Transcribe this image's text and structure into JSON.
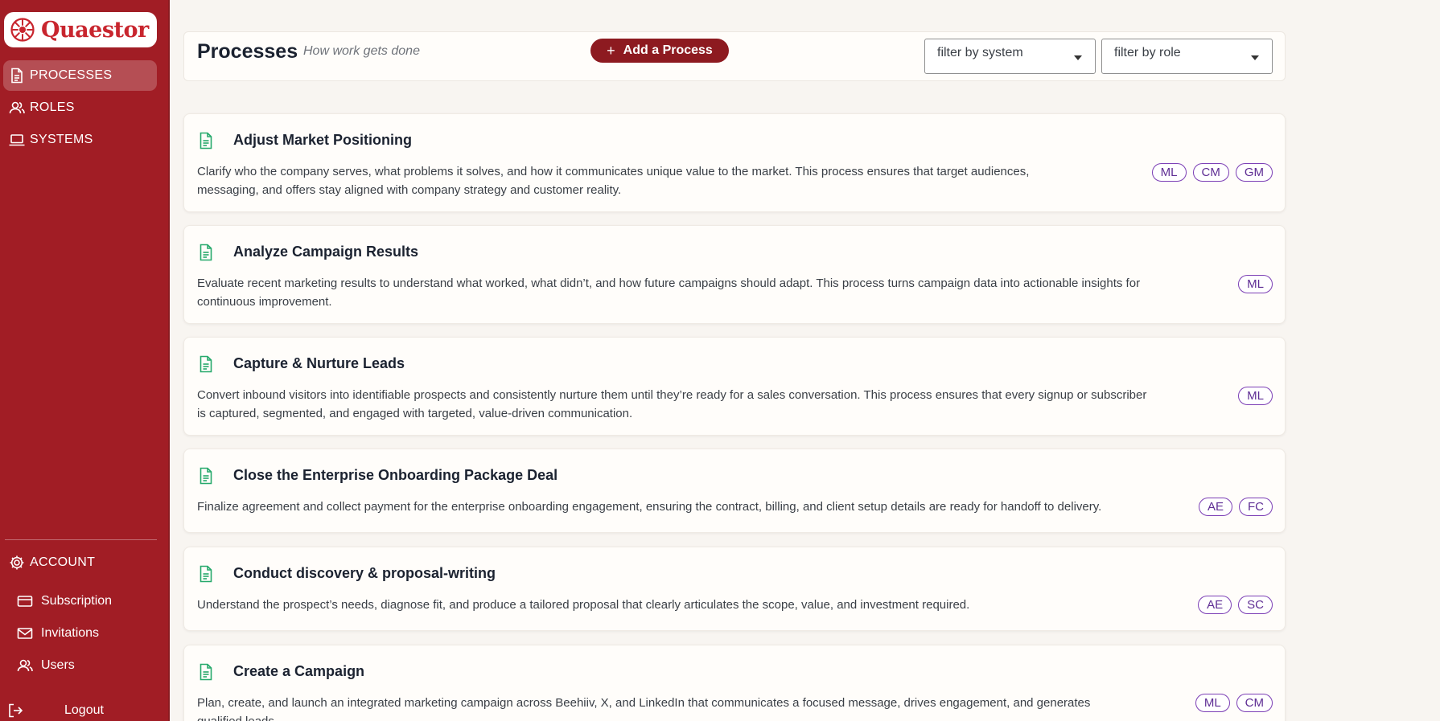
{
  "app": {
    "name": "Quaestor",
    "brand_color": "#a11d25",
    "accent_color": "#7c3fb5",
    "doc_icon_color": "#26a96c"
  },
  "sidebar": {
    "nav": [
      {
        "label": "PROCESSES",
        "icon": "document-icon",
        "active": true
      },
      {
        "label": "ROLES",
        "icon": "users-icon",
        "active": false
      },
      {
        "label": "SYSTEMS",
        "icon": "laptop-icon",
        "active": false
      }
    ],
    "account": {
      "label": "ACCOUNT",
      "icon": "gear-icon"
    },
    "account_items": [
      {
        "label": "Subscription",
        "icon": "credit-card-icon"
      },
      {
        "label": "Invitations",
        "icon": "mail-icon"
      },
      {
        "label": "Users",
        "icon": "users-icon"
      }
    ],
    "logout": {
      "label": "Logout",
      "icon": "logout-icon"
    }
  },
  "header": {
    "title": "Processes",
    "subtitle": "How work gets done",
    "add_button": {
      "icon": "+",
      "label": "Add a Process"
    },
    "filter_system": {
      "value": "filter by system"
    },
    "filter_role": {
      "value": "filter by role"
    }
  },
  "processes": [
    {
      "title": "Adjust Market Positioning",
      "description_lines": [
        "Clarify who the company serves, what problems it solves, and how it communicates unique value to the market. This process ensures that target audiences,",
        "messaging, and offers stay aligned with company strategy and customer reality."
      ],
      "roles": [
        "ML",
        "CM",
        "GM"
      ]
    },
    {
      "title": "Analyze Campaign Results",
      "description_lines": [
        "Evaluate recent marketing results to understand what worked, what didn’t, and how future campaigns should adapt. This process turns campaign data into actionable insights for",
        "continuous improvement."
      ],
      "roles": [
        "ML"
      ]
    },
    {
      "title": "Capture & Nurture Leads",
      "description_lines": [
        "Convert inbound visitors into identifiable prospects and consistently nurture them until they’re ready for a sales conversation. This process ensures that every signup or subscriber",
        "is captured, segmented, and engaged with targeted, value-driven communication."
      ],
      "roles": [
        "ML"
      ]
    },
    {
      "title": "Close the Enterprise Onboarding Package Deal",
      "description_lines": [
        "Finalize agreement and collect payment for the enterprise onboarding engagement, ensuring the contract, billing, and client setup details are ready for handoff to delivery."
      ],
      "roles": [
        "AE",
        "FC"
      ]
    },
    {
      "title": "Conduct discovery & proposal-writing",
      "description_lines": [
        "Understand the prospect’s needs, diagnose fit, and produce a tailored proposal that clearly articulates the scope, value, and investment required."
      ],
      "roles": [
        "AE",
        "SC"
      ]
    },
    {
      "title": "Create a Campaign",
      "description_lines": [
        "Plan, create, and launch an integrated marketing campaign across Beehiiv, X, and LinkedIn that communicates a focused message, drives engagement, and generates",
        "qualified leads."
      ],
      "roles": [
        "ML",
        "CM"
      ]
    }
  ]
}
